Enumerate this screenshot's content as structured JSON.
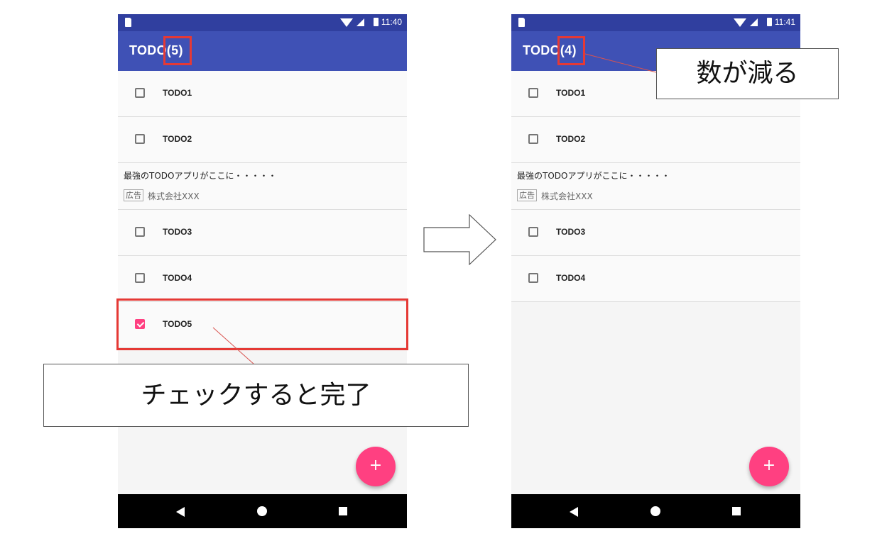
{
  "left_screen": {
    "status_time": "11:40",
    "app_title": "TODO(5)",
    "todos": [
      {
        "label": "TODO1",
        "checked": false
      },
      {
        "label": "TODO2",
        "checked": false
      },
      {
        "label": "TODO3",
        "checked": false
      },
      {
        "label": "TODO4",
        "checked": false
      },
      {
        "label": "TODO5",
        "checked": true
      }
    ],
    "ad": {
      "text": "最強のTODOアプリがここに・・・・・",
      "badge": "広告",
      "company": "株式会社XXX"
    },
    "fab_label": "+"
  },
  "right_screen": {
    "status_time": "11:41",
    "app_title": "TODO(4)",
    "todos": [
      {
        "label": "TODO1",
        "checked": false
      },
      {
        "label": "TODO2",
        "checked": false
      },
      {
        "label": "TODO3",
        "checked": false
      },
      {
        "label": "TODO4",
        "checked": false
      }
    ],
    "ad": {
      "text": "最強のTODOアプリがここに・・・・・",
      "badge": "広告",
      "company": "株式会社XXX"
    },
    "fab_label": "+"
  },
  "annotations": {
    "check_complete": "チェックすると完了",
    "count_decreases": "数が減る"
  },
  "colors": {
    "primary": "#3f51b5",
    "primary_dark": "#303f9f",
    "accent": "#ff4081",
    "highlight": "#e53935"
  },
  "icons": [
    "sd-card-icon",
    "wifi-icon",
    "cell-signal-icon",
    "battery-icon",
    "checkbox-icon",
    "add-icon",
    "nav-back-icon",
    "nav-home-icon",
    "nav-recent-icon",
    "right-arrow-icon"
  ]
}
